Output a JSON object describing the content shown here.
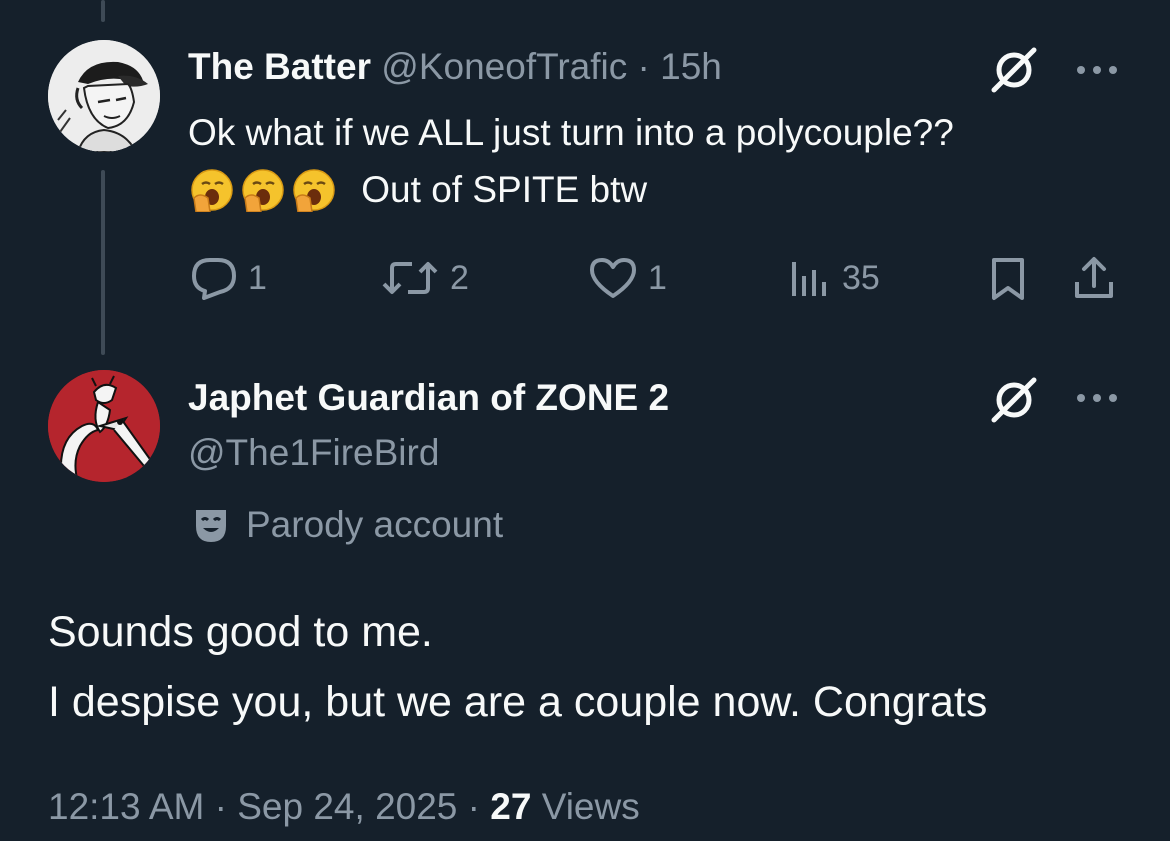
{
  "parent_tweet": {
    "display_name": "The Batter",
    "handle": "@KoneofTrafic",
    "separator": "·",
    "age": "15h",
    "text_line1": "Ok what if we ALL just turn into a polycouple??",
    "text_line2": "Out of SPITE btw",
    "emojis": [
      "yawning-face",
      "yawning-face",
      "yawning-face"
    ],
    "metrics": {
      "replies": "1",
      "reposts": "2",
      "likes": "1",
      "views": "35"
    }
  },
  "reply_tweet": {
    "display_name": "Japhet Guardian of ZONE 2",
    "handle": "@The1FireBird",
    "label": "Parody account",
    "text_line1": "Sounds good to me.",
    "text_line2": "I despise you, but we are a couple now. Congrats",
    "time": "12:13 AM",
    "date": "Sep 24, 2025",
    "views_count": "27",
    "views_label": "Views",
    "separator": "·"
  },
  "colors": {
    "background": "#15202b",
    "primary_text": "#f7f9f9",
    "secondary_text": "#8b98a5",
    "thread_line": "#3e4a56",
    "avatar_red": "#b5252d"
  }
}
